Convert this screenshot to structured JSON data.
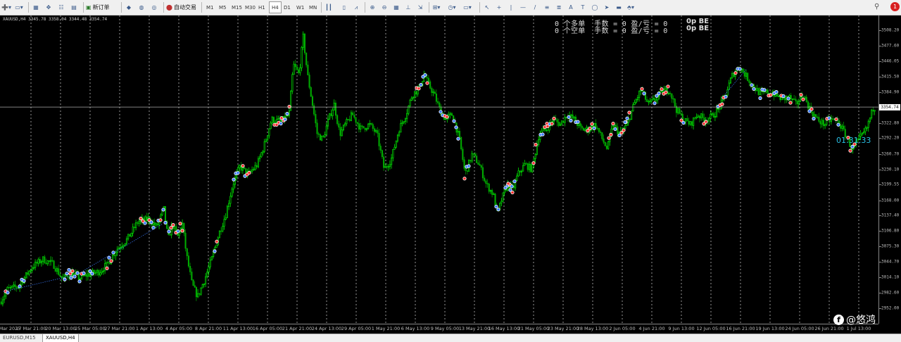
{
  "toolbar": {
    "items": [
      {
        "icon": "new-chart-icon",
        "glyph": "➕▾"
      },
      {
        "icon": "profiles-icon",
        "glyph": "▭▾"
      },
      {
        "icon": "market-watch-icon",
        "glyph": "▦"
      },
      {
        "icon": "navigator-icon",
        "glyph": "✥"
      },
      {
        "icon": "data-window-icon",
        "glyph": "☷"
      },
      {
        "icon": "terminal-icon",
        "glyph": "▤"
      },
      {
        "icon": "new-order-icon",
        "glyph": "▣",
        "label": "新订单"
      },
      {
        "icon": "metaeditor-icon",
        "glyph": "◆"
      },
      {
        "icon": "history-center-icon",
        "glyph": "◍"
      },
      {
        "icon": "strategy-tester-icon",
        "glyph": "◎"
      },
      {
        "icon": "auto-trading-icon",
        "glyph": "⬤",
        "label": "自动交易"
      }
    ],
    "timeframes": [
      "M1",
      "M5",
      "M15",
      "M30",
      "H1",
      "H4",
      "D1",
      "W1",
      "MN"
    ],
    "active_timeframe": "H4",
    "chart_tools": [
      {
        "icon": "bar-chart-icon",
        "glyph": "┃┃"
      },
      {
        "icon": "candlestick-icon",
        "glyph": "▯"
      },
      {
        "icon": "line-chart-icon",
        "glyph": "⩘"
      },
      {
        "icon": "zoom-in-icon",
        "glyph": "⊕"
      },
      {
        "icon": "zoom-out-icon",
        "glyph": "⊖"
      },
      {
        "icon": "tile-windows-icon",
        "glyph": "▦"
      },
      {
        "icon": "chart-shift-icon",
        "glyph": "⊥"
      },
      {
        "icon": "auto-scroll-icon",
        "glyph": "⇲"
      },
      {
        "icon": "indicators-icon",
        "glyph": "⊞▾"
      },
      {
        "icon": "periods-icon",
        "glyph": "◷▾"
      },
      {
        "icon": "templates-icon",
        "glyph": "▭▾"
      },
      {
        "icon": "cursor-icon",
        "glyph": "↖"
      },
      {
        "icon": "crosshair-icon",
        "glyph": "+"
      },
      {
        "icon": "vertical-line-icon",
        "glyph": "|"
      },
      {
        "icon": "horizontal-line-icon",
        "glyph": "—"
      },
      {
        "icon": "trendline-icon",
        "glyph": "/"
      },
      {
        "icon": "equidistant-channel-icon",
        "glyph": "≡"
      },
      {
        "icon": "fibonacci-icon",
        "glyph": "≣"
      },
      {
        "icon": "text-icon",
        "glyph": "A"
      },
      {
        "icon": "text-label-icon",
        "glyph": "T"
      },
      {
        "icon": "ellipse-icon",
        "glyph": "◯"
      },
      {
        "icon": "arrow-icon",
        "glyph": "➤"
      },
      {
        "icon": "rectangle-icon",
        "glyph": "▬"
      },
      {
        "icon": "shapes-icon",
        "glyph": "⬘▾"
      }
    ],
    "search_glyph": "⚲",
    "alert_count": "1"
  },
  "chart_header": {
    "symbol_line": "XAUUSD,H4 3345.78 3358.04 3344.48 3354.74"
  },
  "ea_panel": {
    "line1": "0 个多单  手数 = 0 盈/亏 = 0",
    "line2": "0 个空单  手数 = 0 盈/亏 = 0",
    "be1": "0p BE",
    "be2": "0p BE"
  },
  "timer": "01:31:33",
  "watermark": {
    "icon_glyph": "f",
    "text": "@悠鸿"
  },
  "tabs": [
    "EURUSD,M15",
    "XAUUSD,H4"
  ],
  "active_tab": "XAUUSD,H4",
  "chart_data": {
    "type": "candlestick",
    "symbol": "XAUUSD",
    "timeframe": "H4",
    "last": 3354.74,
    "ylim": [
      2921.0,
      3538.0
    ],
    "y_ticks": [
      "3508.20",
      "3477.60",
      "3446.05",
      "3415.50",
      "3384.90",
      "3353.40",
      "3322.80",
      "3292.20",
      "3260.70",
      "3230.10",
      "3199.55",
      "3168.00",
      "3137.40",
      "3106.80",
      "3075.30",
      "3044.70",
      "3014.10",
      "2982.60",
      "2952.00"
    ],
    "x_labels": [
      "Mar 2025",
      "17 Mar 21:00",
      "20 Mar 13:00",
      "25 Mar 05:00",
      "27 Mar 21:00",
      "1 Apr 13:00",
      "4 Apr 05:00",
      "8 Apr 21:00",
      "11 Apr 13:00",
      "16 Apr 05:00",
      "21 Apr 21:00",
      "24 Apr 13:00",
      "29 Apr 05:00",
      "1 May 21:00",
      "6 May 13:00",
      "9 May 05:00",
      "13 May 21:00",
      "16 May 13:00",
      "21 May 05:00",
      "23 May 21:00",
      "28 May 13:00",
      "2 Jun 05:00",
      "4 Jun 21:00",
      "9 Jun 13:00",
      "12 Jun 05:00",
      "16 Jun 21:00",
      "19 Jun 13:00",
      "24 Jun 05:00",
      "26 Jun 21:00",
      "1 Jul 13:00"
    ],
    "close_path": [
      [
        0,
        2965
      ],
      [
        10,
        2990
      ],
      [
        25,
        2995
      ],
      [
        45,
        3035
      ],
      [
        60,
        3050
      ],
      [
        75,
        3040
      ],
      [
        88,
        3010
      ],
      [
        100,
        3022
      ],
      [
        112,
        3012
      ],
      [
        125,
        3020
      ],
      [
        140,
        3025
      ],
      [
        152,
        3040
      ],
      [
        165,
        3070
      ],
      [
        180,
        3090
      ],
      [
        195,
        3125
      ],
      [
        210,
        3130
      ],
      [
        222,
        3115
      ],
      [
        232,
        3150
      ],
      [
        238,
        3090
      ],
      [
        244,
        3120
      ],
      [
        252,
        3095
      ],
      [
        258,
        3125
      ],
      [
        264,
        3060
      ],
      [
        272,
        3000
      ],
      [
        280,
        2975
      ],
      [
        290,
        3010
      ],
      [
        300,
        3050
      ],
      [
        310,
        3100
      ],
      [
        320,
        3140
      ],
      [
        330,
        3200
      ],
      [
        340,
        3235
      ],
      [
        352,
        3220
      ],
      [
        365,
        3240
      ],
      [
        375,
        3280
      ],
      [
        385,
        3330
      ],
      [
        398,
        3325
      ],
      [
        410,
        3340
      ],
      [
        416,
        3440
      ],
      [
        424,
        3420
      ],
      [
        430,
        3495
      ],
      [
        436,
        3420
      ],
      [
        442,
        3370
      ],
      [
        450,
        3300
      ],
      [
        458,
        3290
      ],
      [
        466,
        3330
      ],
      [
        474,
        3360
      ],
      [
        482,
        3300
      ],
      [
        490,
        3320
      ],
      [
        500,
        3340
      ],
      [
        512,
        3310
      ],
      [
        524,
        3320
      ],
      [
        535,
        3300
      ],
      [
        545,
        3230
      ],
      [
        555,
        3250
      ],
      [
        566,
        3310
      ],
      [
        576,
        3340
      ],
      [
        585,
        3380
      ],
      [
        594,
        3390
      ],
      [
        602,
        3420
      ],
      [
        608,
        3400
      ],
      [
        616,
        3380
      ],
      [
        624,
        3350
      ],
      [
        632,
        3330
      ],
      [
        642,
        3340
      ],
      [
        652,
        3290
      ],
      [
        660,
        3220
      ],
      [
        670,
        3260
      ],
      [
        680,
        3240
      ],
      [
        690,
        3200
      ],
      [
        700,
        3180
      ],
      [
        706,
        3140
      ],
      [
        712,
        3170
      ],
      [
        720,
        3200
      ],
      [
        728,
        3190
      ],
      [
        735,
        3220
      ],
      [
        745,
        3240
      ],
      [
        755,
        3230
      ],
      [
        765,
        3300
      ],
      [
        775,
        3310
      ],
      [
        785,
        3330
      ],
      [
        795,
        3320
      ],
      [
        805,
        3340
      ],
      [
        815,
        3330
      ],
      [
        825,
        3310
      ],
      [
        835,
        3310
      ],
      [
        845,
        3320
      ],
      [
        855,
        3290
      ],
      [
        862,
        3270
      ],
      [
        870,
        3320
      ],
      [
        880,
        3300
      ],
      [
        890,
        3320
      ],
      [
        900,
        3360
      ],
      [
        910,
        3390
      ],
      [
        920,
        3360
      ],
      [
        930,
        3370
      ],
      [
        940,
        3385
      ],
      [
        950,
        3390
      ],
      [
        960,
        3350
      ],
      [
        970,
        3330
      ],
      [
        980,
        3320
      ],
      [
        990,
        3340
      ],
      [
        1000,
        3330
      ],
      [
        1010,
        3335
      ],
      [
        1020,
        3350
      ],
      [
        1030,
        3380
      ],
      [
        1040,
        3420
      ],
      [
        1050,
        3435
      ],
      [
        1060,
        3415
      ],
      [
        1070,
        3395
      ],
      [
        1080,
        3380
      ],
      [
        1090,
        3385
      ],
      [
        1100,
        3380
      ],
      [
        1110,
        3370
      ],
      [
        1120,
        3375
      ],
      [
        1130,
        3360
      ],
      [
        1140,
        3380
      ],
      [
        1150,
        3350
      ],
      [
        1160,
        3330
      ],
      [
        1170,
        3320
      ],
      [
        1180,
        3330
      ],
      [
        1190,
        3325
      ],
      [
        1200,
        3300
      ],
      [
        1210,
        3270
      ],
      [
        1220,
        3290
      ],
      [
        1230,
        3310
      ],
      [
        1240,
        3354
      ]
    ],
    "buy_marker_color": "#3a7bff",
    "sell_marker_color": "#ff3030",
    "bull_color": "#00ff00",
    "bear_color": "#00aa00",
    "grid": true
  }
}
